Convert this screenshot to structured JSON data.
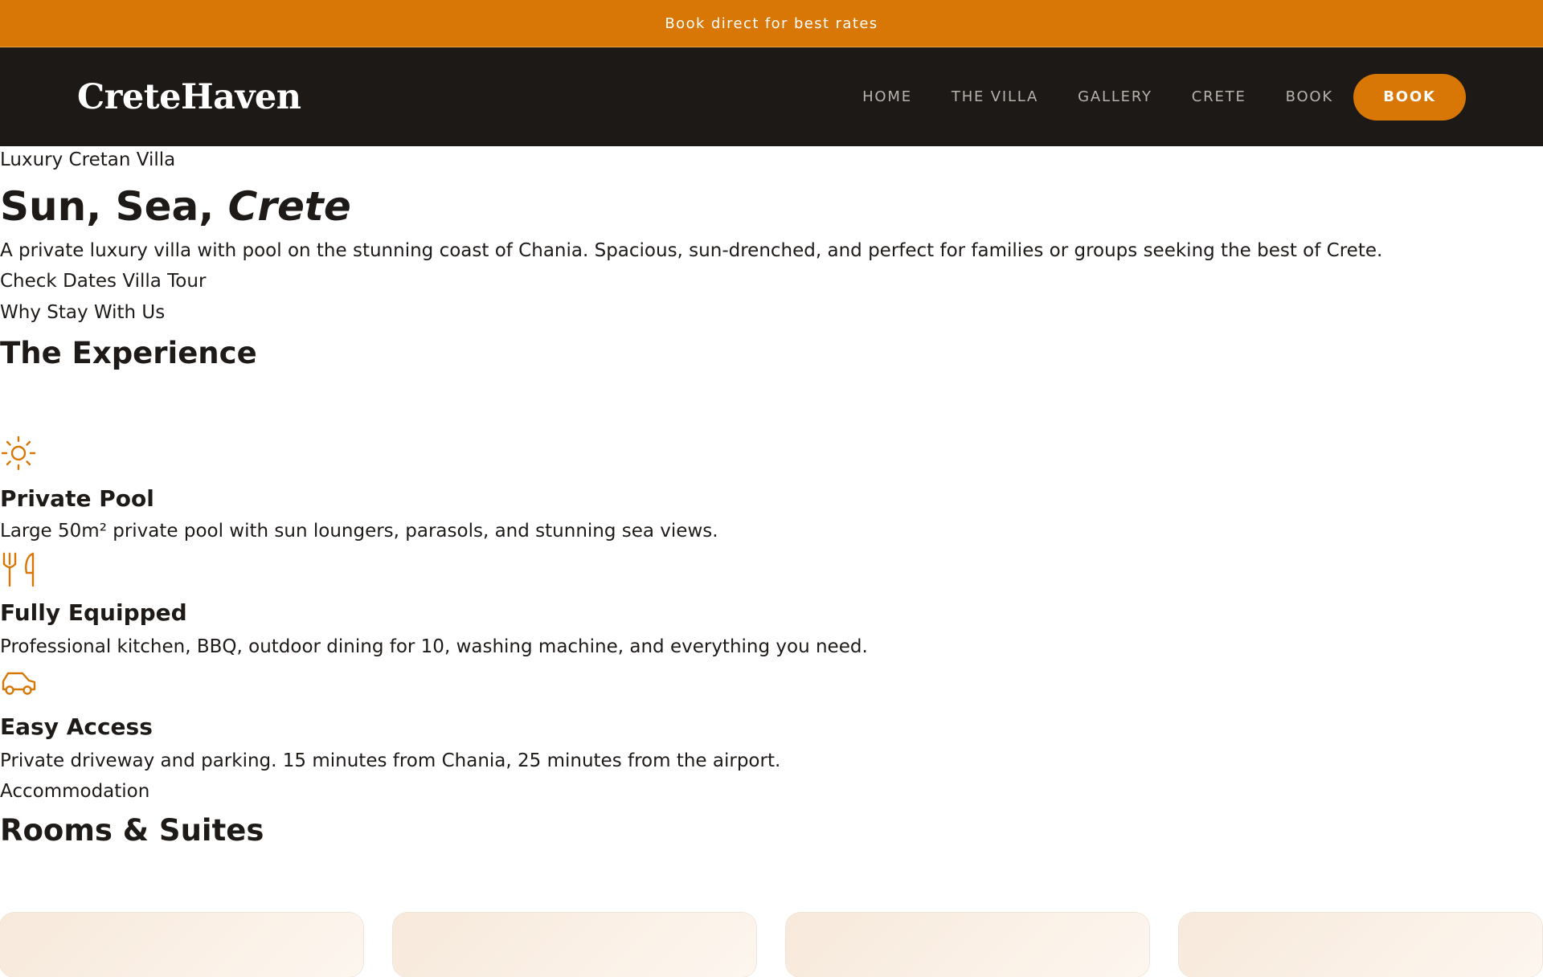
{
  "announcement": "Book direct for best rates",
  "brand": "CreteHaven",
  "nav": {
    "links": [
      "HOME",
      "THE VILLA",
      "GALLERY",
      "CRETE",
      "BOOK"
    ],
    "cta": "BOOK"
  },
  "hero": {
    "eyebrow": "Luxury Cretan Villa",
    "title_plain": "Sun, Sea, ",
    "title_em": "Crete",
    "description": "A private luxury villa with pool on the stunning coast of Chania. Spacious, sun-drenched, and perfect for families or groups seeking the best of Crete.",
    "cta_check": "Check Dates",
    "cta_tour": "Villa Tour"
  },
  "experience": {
    "eyebrow": "Why Stay With Us",
    "title": "The Experience",
    "features": [
      {
        "icon": "sun-icon",
        "title": "Private Pool",
        "text": "Large 50m² private pool with sun loungers, parasols, and stunning sea views."
      },
      {
        "icon": "utensils-icon",
        "title": "Fully Equipped",
        "text": "Professional kitchen, BBQ, outdoor dining for 10, washing machine, and everything you need."
      },
      {
        "icon": "car-icon",
        "title": "Easy Access",
        "text": "Private driveway and parking. 15 minutes from Chania, 25 minutes from the airport."
      }
    ]
  },
  "rooms": {
    "eyebrow": "Accommodation",
    "title": "Rooms & Suites"
  },
  "colors": {
    "accent": "#d97706",
    "nav_bg": "#1d1917",
    "text": "#1e1a18"
  }
}
